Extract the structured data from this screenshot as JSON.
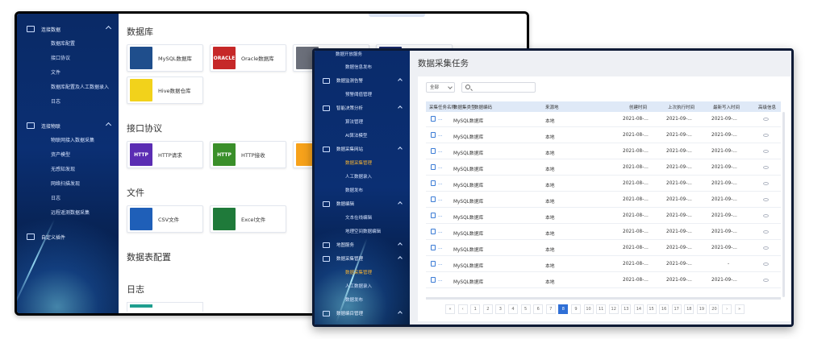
{
  "window1": {
    "sidebar": {
      "groups": [
        {
          "label": "连接数据",
          "subs": [
            "数据库配置",
            "接口协议",
            "文件",
            "数据库配置及人工数据录入",
            "日志"
          ]
        },
        {
          "label": "连接物联",
          "subs": [
            "物联网接入数据采集",
            "资产模型",
            "无感知发现",
            "网络扫描发现",
            "日志",
            "远程遥测数据采集"
          ]
        },
        {
          "label": "自定义插件",
          "subs": []
        }
      ]
    },
    "sections": [
      {
        "title": "数据库",
        "cards": [
          {
            "label": "MySQL数据库",
            "icon": "mysql-dolphin-icon",
            "color": "#1f4e8c"
          },
          {
            "label": "Oracle数据库",
            "icon": "oracle-logo-icon",
            "color": "#c62828",
            "logo_text": "ORACLE"
          },
          {
            "label": "",
            "icon": "db-gray-icon",
            "color": "#6b6f7a"
          },
          {
            "label": "",
            "icon": "db-navy-icon",
            "color": "#1a2a6e"
          },
          {
            "label": "Hive数据仓库",
            "icon": "hive-bee-icon",
            "color": "#f2d21b"
          }
        ]
      },
      {
        "title": "接口协议",
        "cards": [
          {
            "label": "HTTP请求",
            "icon": "http-purple-icon",
            "color": "#5b2db3",
            "logo_text": "HTTP"
          },
          {
            "label": "HTTP接收",
            "icon": "http-green-icon",
            "color": "#3a8f2a",
            "logo_text": "HTTP"
          },
          {
            "label": "",
            "icon": "orange-icon",
            "color": "#f7a21b"
          }
        ]
      },
      {
        "title": "文件",
        "cards": [
          {
            "label": "CSV文件",
            "icon": "csv-file-icon",
            "color": "#1f5fb8"
          },
          {
            "label": "Excel文件",
            "icon": "excel-file-icon",
            "color": "#1f7a3a"
          }
        ]
      },
      {
        "title": "数据表配置",
        "cards": []
      },
      {
        "title": "日志",
        "cards": []
      }
    ]
  },
  "window2": {
    "sidebar": {
      "top_partial": "数据开放服务",
      "items": [
        {
          "type": "sub",
          "label": "数据信息发布"
        },
        {
          "type": "group",
          "label": "数据监测告警"
        },
        {
          "type": "sub",
          "label": "预警阈值管理"
        },
        {
          "type": "group",
          "label": "智能决策分析"
        },
        {
          "type": "sub",
          "label": "算法管理"
        },
        {
          "type": "sub",
          "label": "AI算法模型"
        },
        {
          "type": "group",
          "label": "数据采集网站"
        },
        {
          "type": "sub",
          "label": "数据采集管理",
          "active": true
        },
        {
          "type": "sub",
          "label": "人工数据录入"
        },
        {
          "type": "sub",
          "label": "数据发布"
        },
        {
          "type": "group",
          "label": "数据编辑"
        },
        {
          "type": "sub",
          "label": "文本在线编辑"
        },
        {
          "type": "sub",
          "label": "地理空间数据编辑"
        },
        {
          "type": "group",
          "label": "地图服务"
        },
        {
          "type": "group",
          "label": "数据采集管理"
        },
        {
          "type": "sub",
          "label": "数据采集管理",
          "active": true
        },
        {
          "type": "sub",
          "label": "人工数据录入"
        },
        {
          "type": "sub",
          "label": "数据发布"
        },
        {
          "type": "group",
          "label": "数据编目管理"
        }
      ]
    },
    "page_title": "数据采集任务",
    "filter": {
      "select_value": "全部",
      "search_placeholder": ""
    },
    "table": {
      "headers": [
        "采集任务名称",
        "数据集类型",
        "数据编码",
        "来源地",
        "创建时间",
        "上次执行时间",
        "最新写入时间",
        "高级信息"
      ],
      "rows": [
        {
          "type": "MySQL数据库",
          "source": "本地",
          "created": "2021-08-...",
          "last_run": "2021-09-...",
          "last_write": "2021-09-..."
        },
        {
          "type": "MySQL数据库",
          "source": "本地",
          "created": "2021-08-...",
          "last_run": "2021-09-...",
          "last_write": "2021-09-..."
        },
        {
          "type": "MySQL数据库",
          "source": "本地",
          "created": "2021-08-...",
          "last_run": "2021-09-...",
          "last_write": "2021-09-..."
        },
        {
          "type": "MySQL数据库",
          "source": "本地",
          "created": "2021-08-...",
          "last_run": "2021-09-...",
          "last_write": "2021-09-..."
        },
        {
          "type": "MySQL数据库",
          "source": "本地",
          "created": "2021-08-...",
          "last_run": "2021-09-...",
          "last_write": "2021-09-..."
        },
        {
          "type": "MySQL数据库",
          "source": "本地",
          "created": "2021-08-...",
          "last_run": "2021-09-...",
          "last_write": "2021-09-..."
        },
        {
          "type": "MySQL数据库",
          "source": "本地",
          "created": "2021-08-...",
          "last_run": "2021-09-...",
          "last_write": "2021-09-..."
        },
        {
          "type": "MySQL数据库",
          "source": "本地",
          "created": "2021-08-...",
          "last_run": "2021-09-...",
          "last_write": "2021-09-..."
        },
        {
          "type": "MySQL数据库",
          "source": "本地",
          "created": "2021-08-...",
          "last_run": "2021-09-...",
          "last_write": "2021-09-..."
        },
        {
          "type": "MySQL数据库",
          "source": "本地",
          "created": "2021-08-...",
          "last_run": "2021-09-...",
          "last_write": "-"
        },
        {
          "type": "MySQL数据库",
          "source": "本地",
          "created": "2021-08-...",
          "last_run": "2021-09-...",
          "last_write": "2021-09-..."
        }
      ],
      "row_ellipsis": "..."
    },
    "pagination": {
      "items": [
        "«",
        "‹",
        "1",
        "2",
        "3",
        "4",
        "5",
        "6",
        "7",
        "8",
        "9",
        "10",
        "11",
        "12",
        "13",
        "14",
        "15",
        "16",
        "17",
        "18",
        "19",
        "20",
        "›",
        "»"
      ],
      "active": "8"
    }
  }
}
